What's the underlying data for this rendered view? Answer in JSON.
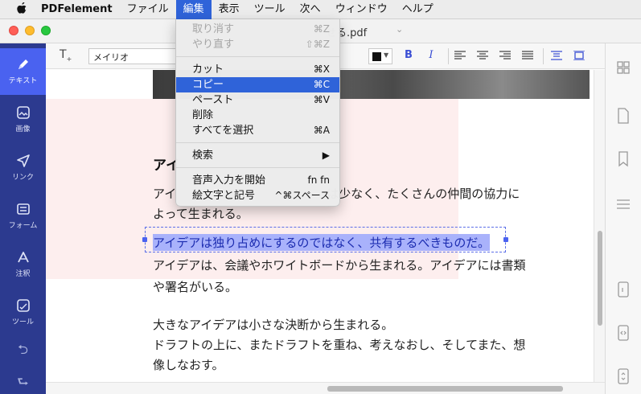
{
  "menubar": {
    "app_name": "PDFelement",
    "items": [
      "ファイル",
      "編集",
      "表示",
      "ツール",
      "次へ",
      "ウィンドウ",
      "ヘルプ"
    ],
    "active_item": "編集"
  },
  "window": {
    "doc_title": "せる.pdf"
  },
  "sidebar": {
    "items": [
      {
        "label": "テキスト",
        "icon": "pen-icon",
        "active": true
      },
      {
        "label": "画像",
        "icon": "image-icon"
      },
      {
        "label": "リンク",
        "icon": "link-icon"
      },
      {
        "label": "フォーム",
        "icon": "form-icon"
      },
      {
        "label": "注釈",
        "icon": "annotate-icon"
      },
      {
        "label": "ツール",
        "icon": "tool-icon"
      }
    ]
  },
  "toolbar": {
    "font_name": "メイリオ",
    "bold": "B",
    "italic": "I",
    "text_color": "#111111"
  },
  "document": {
    "heading": "アイ",
    "line1a": "アイ",
    "line1b": "は少なく、たくさんの仲間の協力に",
    "line2": "よって生まれる。",
    "selected_line": "アイデアは独り占めにするのではなく、共有するべきものだ。",
    "line4": "アイデアは、会議やホワイトボードから生まれる。アイデアには書類",
    "line5": "や署名がいる。",
    "line6": "大きなアイデアは小さな決断から生まれる。",
    "line7": "ドラフトの上に、またドラフトを重ね、考えなおし、そしてまた、想",
    "line8": "像しなおす。"
  },
  "edit_menu": {
    "undo": {
      "label": "取り消す",
      "shortcut": "⌘Z"
    },
    "redo": {
      "label": "やり直す",
      "shortcut": "⇧⌘Z"
    },
    "cut": {
      "label": "カット",
      "shortcut": "⌘X"
    },
    "copy": {
      "label": "コピー",
      "shortcut": "⌘C"
    },
    "paste": {
      "label": "ペースト",
      "shortcut": "⌘V"
    },
    "delete": {
      "label": "削除"
    },
    "select_all": {
      "label": "すべてを選択",
      "shortcut": "⌘A"
    },
    "find": {
      "label": "検索",
      "shortcut": "▶"
    },
    "dictation": {
      "label": "音声入力を開始",
      "shortcut": "fn fn"
    },
    "emoji": {
      "label": "絵文字と記号",
      "shortcut": "^⌘スペース"
    }
  },
  "colors": {
    "accent": "#4a62f0",
    "sidebar": "#2c3a8f",
    "selection": "#a9b2fb",
    "menu_highlight": "#2f63d9"
  }
}
